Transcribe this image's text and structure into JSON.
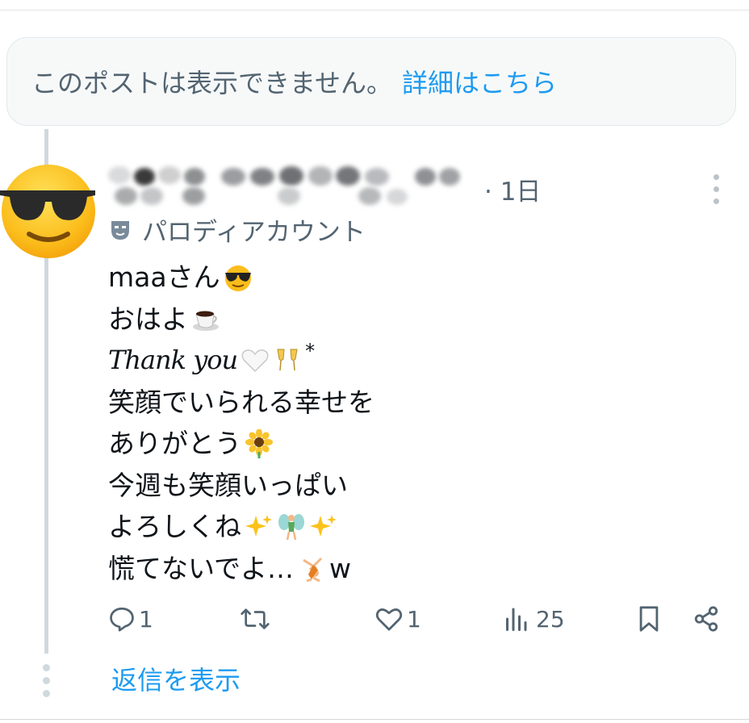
{
  "notice": {
    "text": "このポストは表示できません。",
    "link": "詳細はこちら"
  },
  "post": {
    "time": "· 1日",
    "badge_label": "パロディアカウント",
    "lines": [
      "maaさん",
      "おはよ",
      "Thank you",
      "*",
      "笑顔でいられる幸せを",
      "ありがとう",
      "今週も笑顔いっぱい",
      "よろしくね",
      "慌てないでよ…",
      "w"
    ],
    "replies": "1",
    "likes": "1",
    "views": "25"
  },
  "thread": {
    "show_replies": "返信を表示"
  },
  "icons": [
    "reply-icon",
    "repost-icon",
    "like-icon",
    "views-icon",
    "bookmark-icon",
    "share-icon",
    "more-icon",
    "mask-icon"
  ],
  "colors": {
    "link": "#1d9bf0",
    "secondary": "#536471",
    "line": "#cfd9de"
  }
}
